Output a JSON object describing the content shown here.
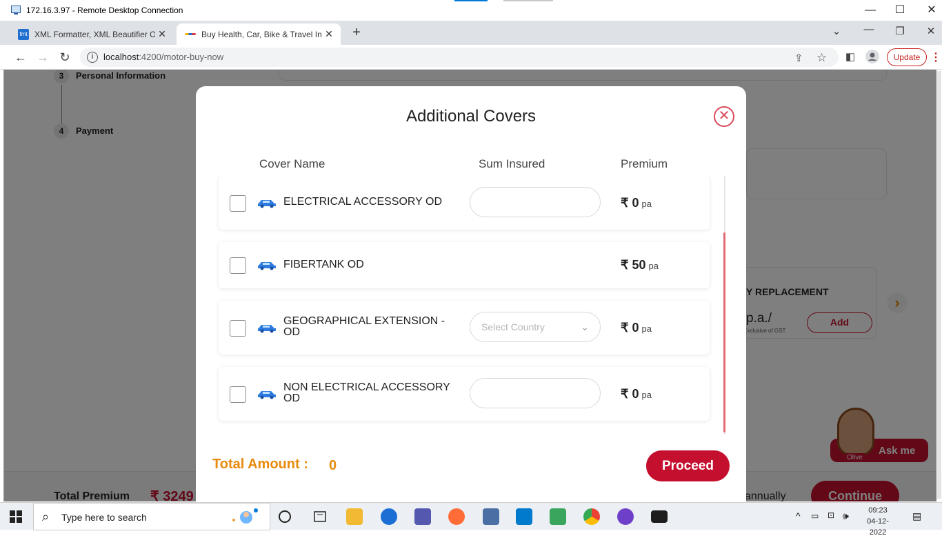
{
  "rdp": {
    "title": "172.16.3.97 - Remote Desktop Connection",
    "minimize": "—",
    "maximize": "☐",
    "close": "✕"
  },
  "browser": {
    "tabs": [
      {
        "title": "XML Formatter, XML Beautifier O",
        "favicon": "fmt-icon",
        "close": "✕"
      },
      {
        "title": "Buy Health, Car, Bike & Travel Ins",
        "favicon": "site-icon",
        "close": "✕"
      }
    ],
    "new_tab": "+",
    "url_host": "localhost",
    "url_path": ":4200/motor-buy-now",
    "update_label": "Update",
    "kebab": "⋮"
  },
  "background_page": {
    "steps": [
      {
        "num": "3",
        "label": "Personal Information"
      },
      {
        "num": "4",
        "label": "Payment"
      }
    ],
    "card_title": "Y REPLACEMENT",
    "card_price": "p.a./",
    "card_note": "Exclusive of GST",
    "add_label": "Add",
    "total_premium_label": "Total Premium",
    "total_premium_value": "₹ 3249",
    "annually": "annually",
    "continue_label": "Continue",
    "ask_me": "Ask me",
    "olive": "Olive"
  },
  "modal": {
    "title": "Additional Covers",
    "close": "✕",
    "columns": {
      "cover_name": "Cover Name",
      "sum_insured": "Sum Insured",
      "premium": "Premium"
    },
    "covers": [
      {
        "name": "ELECTRICAL ACCESSORY OD",
        "sum_type": "input",
        "sum_value": "",
        "premium": "₹ 0",
        "unit": "pa"
      },
      {
        "name": "FIBERTANK OD",
        "sum_type": "none",
        "sum_value": "",
        "premium": "₹ 50",
        "unit": "pa"
      },
      {
        "name": "GEOGRAPHICAL EXTENSION - OD",
        "sum_type": "select",
        "sum_value": "Select Country",
        "premium": "₹ 0",
        "unit": "pa"
      },
      {
        "name": "NON ELECTRICAL ACCESSORY OD",
        "sum_type": "input",
        "sum_value": "",
        "premium": "₹ 0",
        "unit": "pa"
      }
    ],
    "total_label": "Total Amount :",
    "total_value": "0",
    "proceed_label": "Proceed",
    "colors": {
      "accent": "#c4102e",
      "total": "#e88a0c",
      "scroll": "#e26a74"
    }
  },
  "taskbar": {
    "search_placeholder": "Type here to search",
    "time": "09:23",
    "date": "04-12-2022"
  }
}
